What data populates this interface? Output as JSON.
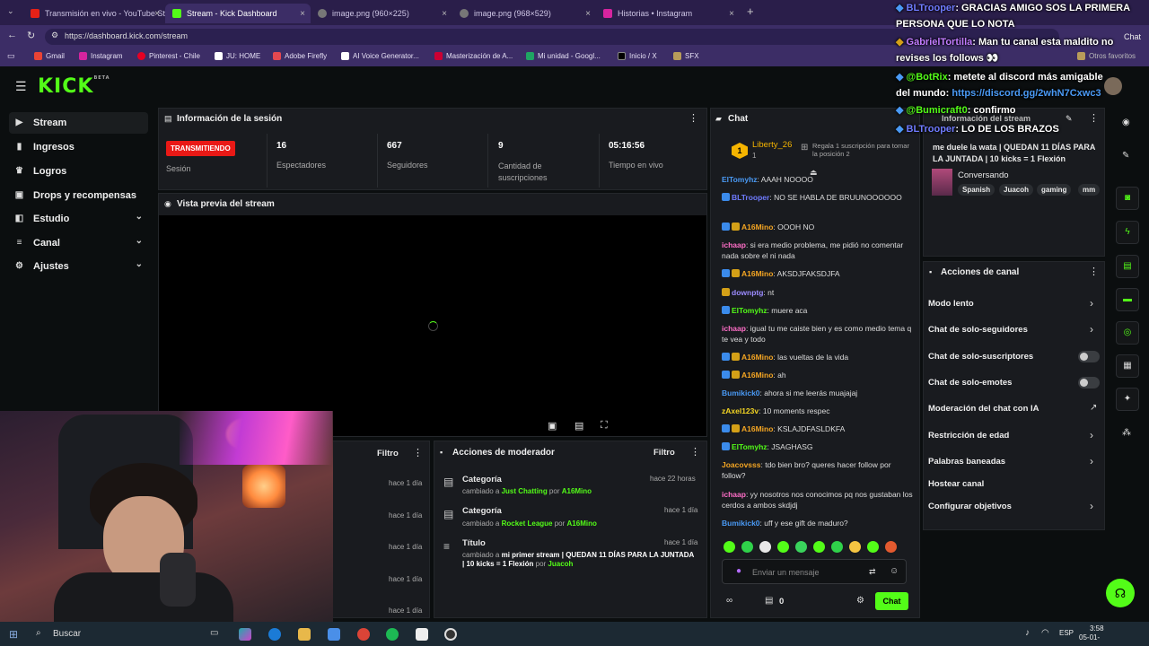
{
  "browser": {
    "tabs": [
      {
        "label": "Transmisión en vivo - YouTube St...",
        "close": "×"
      },
      {
        "label": "Stream - Kick Dashboard",
        "close": "×"
      },
      {
        "label": "image.png (960×225)",
        "close": "×"
      },
      {
        "label": "image.png (968×529)",
        "close": "×"
      },
      {
        "label": "Historias • Instagram",
        "close": "×"
      }
    ],
    "new_tab": "+",
    "url": "https://dashboard.kick.com/stream",
    "bookmarks": [
      "Gmail",
      "Instagram",
      "Pinterest - Chile",
      "JU: HOME",
      "Adobe Firefly",
      "AI Voice Generator...",
      "Masterización de A...",
      "Mi unidad - Googl...",
      "Inicio / X",
      "SFX"
    ],
    "other_bookmarks": "Otros favoritos",
    "chat_label": "Chat"
  },
  "kick": {
    "logo": "KICK",
    "logo_sup": "BETA"
  },
  "sidebar": {
    "items": [
      {
        "label": "Stream"
      },
      {
        "label": "Ingresos"
      },
      {
        "label": "Logros"
      },
      {
        "label": "Drops y recompensas"
      },
      {
        "label": "Estudio"
      },
      {
        "label": "Canal"
      },
      {
        "label": "Ajustes"
      }
    ]
  },
  "session": {
    "title": "Información de la sesión",
    "live_badge": "TRANSMITIENDO",
    "session_label": "Sesión",
    "viewers": "16",
    "viewers_label": "Espectadores",
    "followers": "667",
    "followers_label": "Seguidores",
    "subs": "9",
    "subs_label": "Cantidad de suscripciones",
    "uptime": "05:16:56",
    "uptime_label": "Tiempo en vivo"
  },
  "preview": {
    "title": "Vista previa del stream"
  },
  "filter_label": "Filtro",
  "activity": {
    "times": [
      "hace 1 día",
      "hace 1 día",
      "hace 1 día",
      "hace 1 día",
      "hace 1 día"
    ]
  },
  "mod": {
    "title": "Acciones de moderador",
    "filter": "Filtro",
    "items": [
      {
        "title": "Categoría",
        "pre": "cambiado a ",
        "value": "Just Chatting",
        "by": " por ",
        "user": "A16Mino",
        "time": "hace 22 horas"
      },
      {
        "title": "Categoría",
        "pre": "cambiado a ",
        "value": "Rocket League",
        "by": " por ",
        "user": "A16Mino",
        "time": "hace 1 día"
      },
      {
        "title": "Título",
        "pre": "cambiado a ",
        "value": "mi primer stream | QUEDAN 11 DÍAS PARA LA JUNTADA | 10 kicks = 1 Flexión",
        "by": " por ",
        "user": "Juacoh",
        "time": "hace 1 día"
      }
    ]
  },
  "chat": {
    "title": "Chat",
    "top_gifter": "Liberty_26",
    "top_gifter_count": "1",
    "gift_text": "Regala 1 suscripción para tomar la posición 2",
    "messages": [
      {
        "user": "ElTomyhz",
        "text": ": AAAH NOOOO"
      },
      {
        "user": "BLTrooper",
        "text": ": NO SE HABLA DE BRUUNOOOOOO"
      },
      {
        "user": "A16Mino",
        "text": ": OOOH NO"
      },
      {
        "user": "ichaap",
        "text": ": si era medio problema, me pidió no comentar nada sobre el ni nada"
      },
      {
        "user": "A16Mino",
        "text": ": AKSDJFAKSDJFA"
      },
      {
        "user": "downptg",
        "text": ": nt"
      },
      {
        "user": "ElTomyhz",
        "text": ": muere aca"
      },
      {
        "user": "ichaap",
        "text": ": igual tu me caiste bien y es como medio tema q te vea y todo"
      },
      {
        "user": "A16Mino",
        "text": ": las vueltas de la vida"
      },
      {
        "user": "A16Mino",
        "text": ": ah"
      },
      {
        "user": "Bumikick0",
        "text": ": ahora si me leerás muajajaj"
      },
      {
        "user": "zAxel123v",
        "text": ": 10 moments respec"
      },
      {
        "user": "A16Mino",
        "text": ": KSLAJDFASLDKFA"
      },
      {
        "user": "ElTomyhz",
        "text": ": JSAGHASG"
      },
      {
        "user": "Joacovsss",
        "text": ": tdo bien bro? queres hacer follow por follow?"
      },
      {
        "user": "ichaap",
        "text": ": yy nosotros nos conocimos pq nos gustaban los cerdos a ambos skdjdj"
      },
      {
        "user": "Bumikick0",
        "text": ": uff y ese gift de maduro?"
      }
    ],
    "input_placeholder": "Enviar un mensaje",
    "points": "0",
    "send_label": "Chat"
  },
  "stream_info": {
    "title": "Información del stream",
    "stream_title": "me duele la wata | QUEDAN 11 DÍAS PARA LA JUNTADA | 10 kicks = 1 Flexión",
    "category": "Conversando",
    "tags": [
      "Spanish",
      "Juacoh",
      "gaming",
      "mm"
    ]
  },
  "channel_actions": {
    "title": "Acciones de canal",
    "items": [
      "Modo lento",
      "Chat de solo-seguidores",
      "Chat de solo-suscriptores",
      "Chat de solo-emotes",
      "Moderación del chat con IA",
      "Restricción de edad",
      "Palabras baneadas",
      "Hostear canal",
      "Configurar objetivos"
    ]
  },
  "overlay_chat": [
    {
      "user": "BLTrooper",
      "text": ": GRACIAS AMIGO SOS LA PRIMERA PERSONA QUE LO NOTA"
    },
    {
      "user": "GabrielTortilla",
      "text": ": Man tu canal esta maldito no revises los follows 👀"
    },
    {
      "user": "@BotRix",
      "text": ": metete al discord más amigable del mundo: ",
      "link": "https://discord.gg/2whN7Cxwc3"
    },
    {
      "user": "@Bumicraft0",
      "text": ": confirmo"
    },
    {
      "user": "BLTrooper",
      "text": ": LO DE LOS BRAZOS"
    }
  ],
  "taskbar": {
    "search": "Buscar",
    "lang": "ESP",
    "time": "3:58",
    "date": "05-01-"
  },
  "colors": {
    "kick_green": "#53fc18",
    "live_red": "#e91916",
    "panel": "#191b1f"
  }
}
